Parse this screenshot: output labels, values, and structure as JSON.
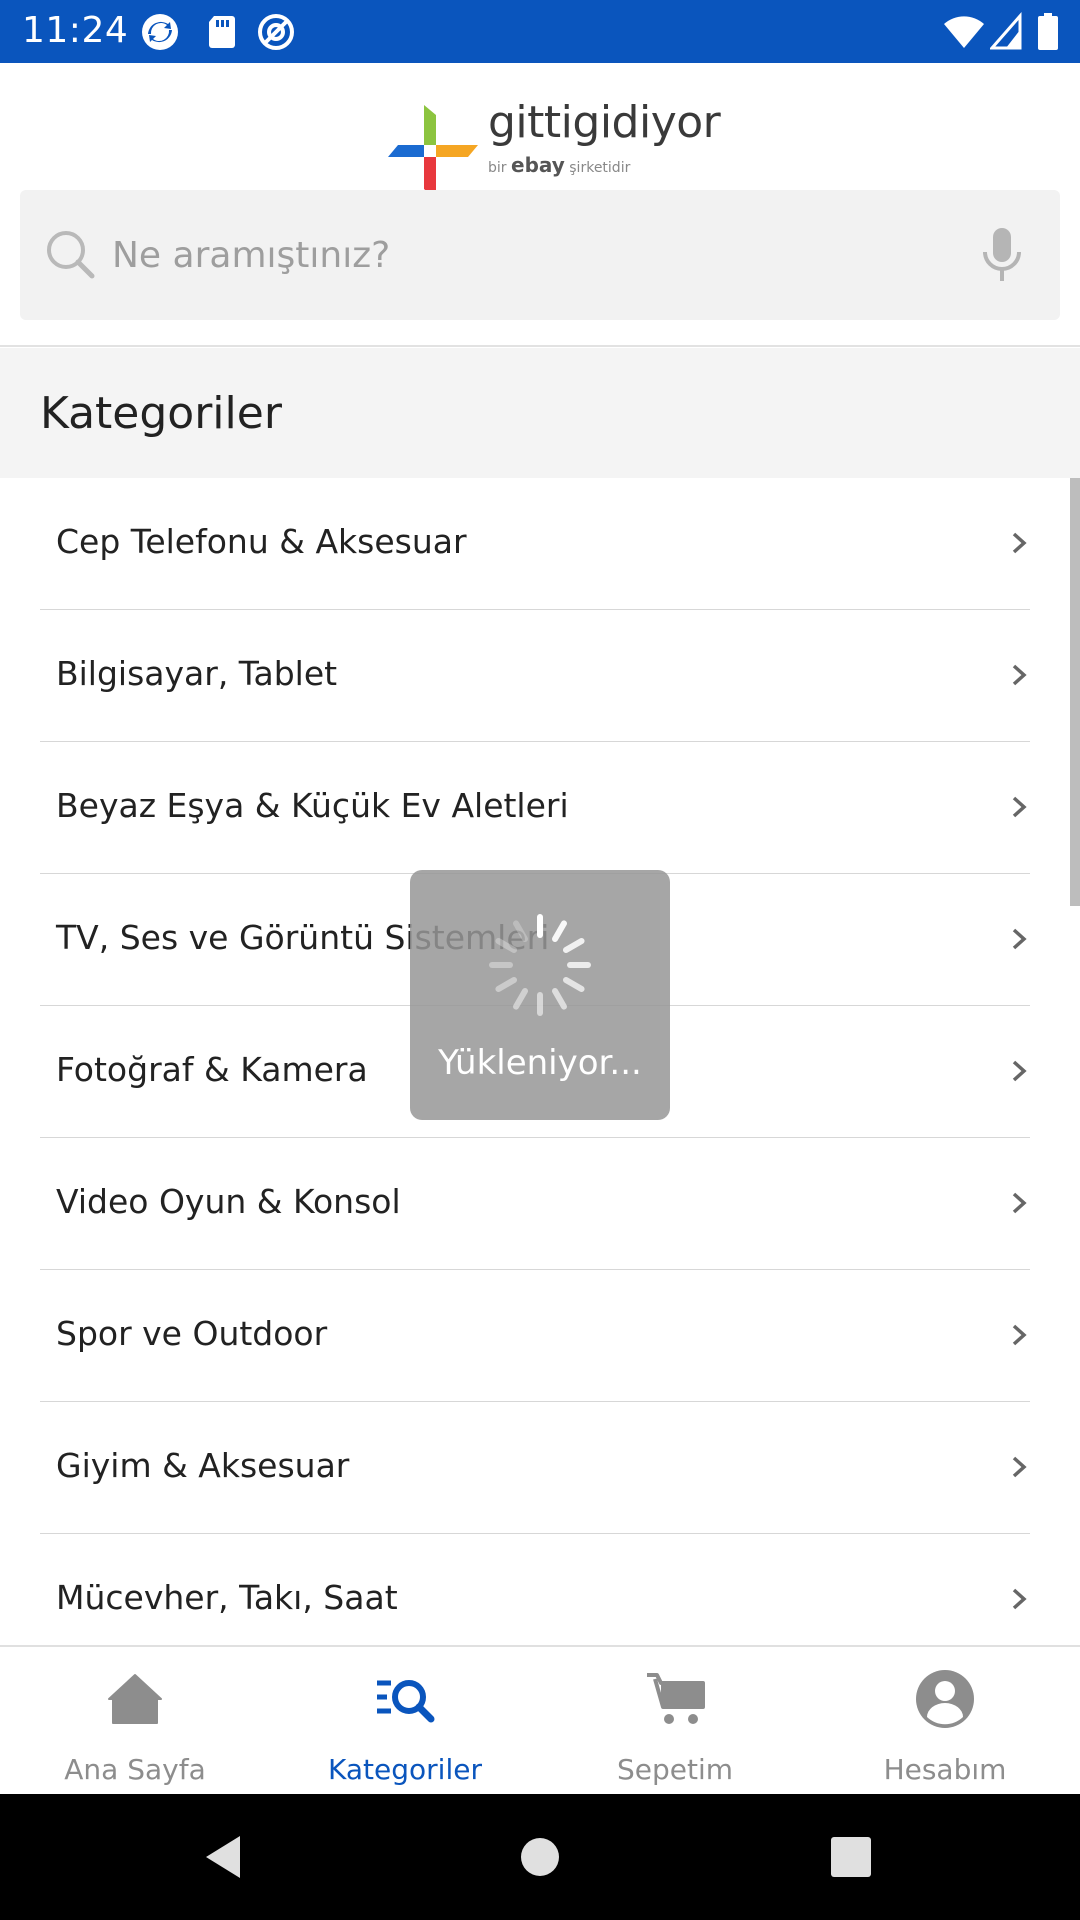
{
  "status_bar": {
    "time": "11:24",
    "left_icons": [
      "sync-icon",
      "sd-card-icon",
      "at-icon"
    ],
    "right_icons": [
      "wifi-icon",
      "signal-icon",
      "battery-icon"
    ],
    "background": "#0a55bd"
  },
  "header": {
    "logo_text": "gittigidiyor",
    "logo_sub_prefix": "bir",
    "logo_sub_brand": "ebay",
    "logo_sub_suffix": "şirketidir",
    "search_placeholder": "Ne aramıştınız?"
  },
  "categories": {
    "title": "Kategoriler",
    "items": [
      {
        "label": "Cep Telefonu & Aksesuar"
      },
      {
        "label": "Bilgisayar, Tablet"
      },
      {
        "label": "Beyaz Eşya & Küçük Ev Aletleri"
      },
      {
        "label": "TV, Ses ve Görüntü Sistemleri"
      },
      {
        "label": "Fotoğraf & Kamera"
      },
      {
        "label": "Video Oyun & Konsol"
      },
      {
        "label": "Spor ve Outdoor"
      },
      {
        "label": "Giyim & Aksesuar"
      },
      {
        "label": "Mücevher, Takı, Saat"
      }
    ]
  },
  "loading": {
    "text": "Yükleniyor..."
  },
  "bottom_nav": {
    "active": "Kategoriler",
    "accent": "#0a55bd",
    "inactive_color": "#8d8d8d",
    "tabs": [
      {
        "label": "Ana Sayfa",
        "icon": "home-icon"
      },
      {
        "label": "Kategoriler",
        "icon": "categories-search-icon"
      },
      {
        "label": "Sepetim",
        "icon": "cart-icon"
      },
      {
        "label": "Hesabım",
        "icon": "account-icon"
      }
    ]
  },
  "system_nav": [
    "back-button",
    "home-button",
    "recents-button"
  ]
}
